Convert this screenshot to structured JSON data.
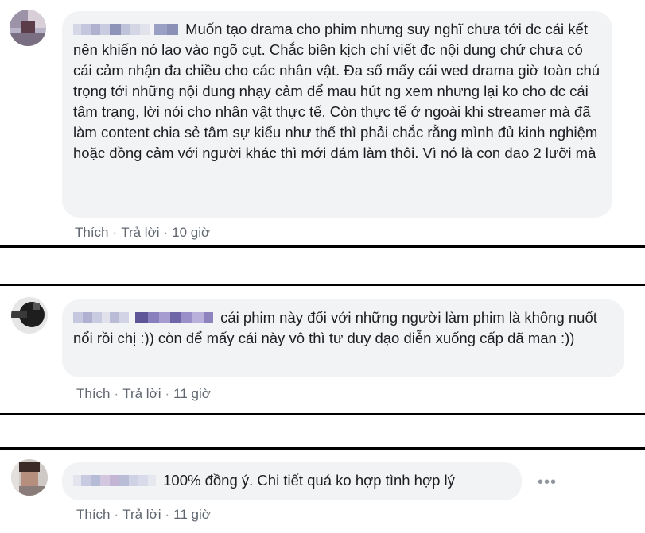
{
  "comments": [
    {
      "text": "Muốn tạo drama cho phim nhưng suy nghĩ chưa tới đc cái kết nên khiến nó lao vào ngõ cụt. Chắc biên kịch chỉ viết đc nội dung chứ chưa có cái cảm nhận đa chiều cho các nhân vật. Đa số mấy cái wed drama giờ toàn chú trọng tới những nội dung nhạy cảm để mau hút ng xem nhưng lại ko cho đc cái tâm trạng, lời nói cho nhân vật thực tế. Còn thực tế ở ngoài khi streamer mà đã làm content chia sẻ tâm sự kiểu như thế thì phải chắc rằng mình đủ kinh nghiệm hoặc đồng cảm với người khác thì mới dám làm thôi. Vì nó là con dao 2 lưỡi mà",
      "like": "Thích",
      "reply": "Trả lời",
      "time": "10 giờ"
    },
    {
      "text": "cái phim này đối với những người làm phim là không nuốt nổi rồi chị :)) còn để mấy cái này vô thì tư duy đạo diễn xuống cấp dã man :))",
      "like": "Thích",
      "reply": "Trả lời",
      "time": "11 giờ"
    },
    {
      "text": "100% đồng ý. Chi tiết quá ko hợp tình hợp lý",
      "like": "Thích",
      "reply": "Trả lời",
      "time": "11 giờ"
    }
  ],
  "colors": {
    "bubble": "#f2f3f5",
    "text": "#1c1e21",
    "meta": "#606770"
  },
  "icons": {
    "more": "more-options-icon"
  },
  "more_glyph": "•••"
}
